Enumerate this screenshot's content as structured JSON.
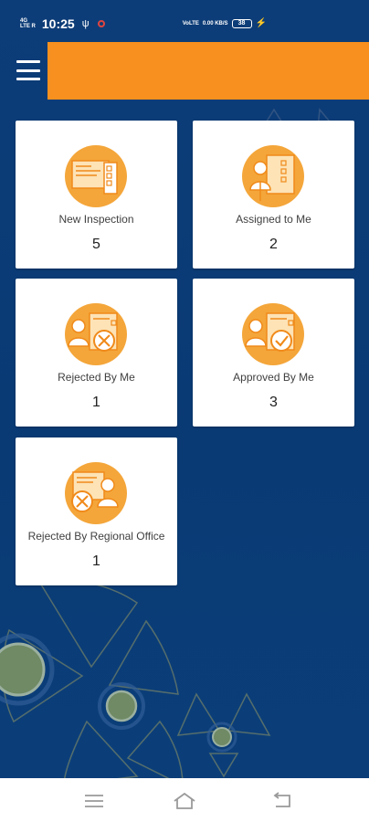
{
  "status_bar": {
    "left_top": "4G",
    "left_bottom": "LTE R",
    "time": "10:25",
    "usb": "ψ",
    "network": "VoLTE",
    "speed": "0.00 KB/S",
    "battery": "38",
    "bolt": "⚡"
  },
  "app_bar": {
    "accent": "#f7901e",
    "menu_icon": "hamburger-menu-icon"
  },
  "cards": [
    {
      "label": "New Inspection",
      "count": "5",
      "icon": "document-form-icon"
    },
    {
      "label": "Assigned to Me",
      "count": "2",
      "icon": "assigned-user-icon"
    },
    {
      "label": "Rejected By Me",
      "count": "1",
      "icon": "rejected-x-icon"
    },
    {
      "label": "Approved By Me",
      "count": "3",
      "icon": "approved-check-icon"
    },
    {
      "label": "Rejected By Regional Office",
      "count": "1",
      "icon": "regional-rejected-icon"
    }
  ],
  "colors": {
    "background": "#0b3a73",
    "icon_orange": "#f4a63a",
    "card": "#ffffff"
  },
  "nav_bar": {
    "recent": "recent-apps-icon",
    "home": "home-icon",
    "back": "back-icon"
  }
}
